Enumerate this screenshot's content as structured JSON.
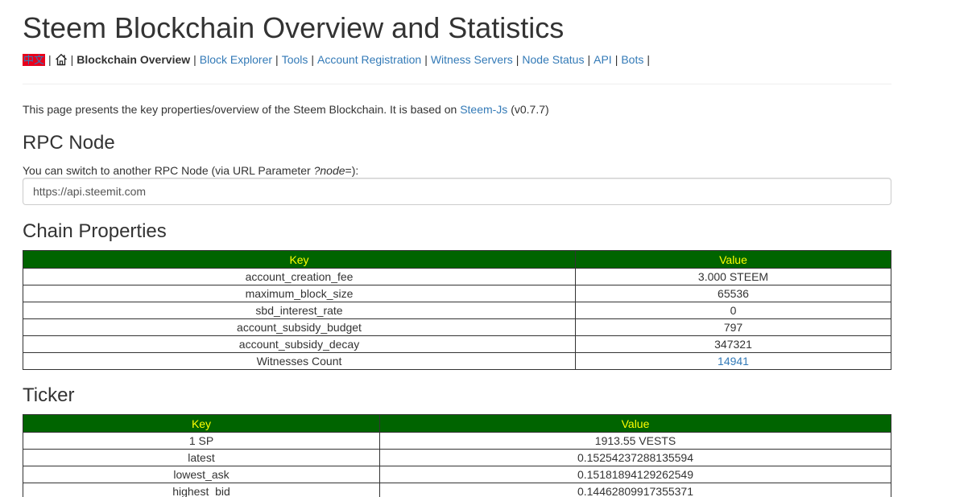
{
  "header": {
    "title": "Steem Blockchain Overview and Statistics"
  },
  "nav": {
    "lang_label": "中文",
    "separator": "|",
    "active_label": "Blockchain Overview",
    "links": [
      "Block Explorer",
      "Tools",
      "Account Registration",
      "Witness Servers",
      "Node Status",
      "API",
      "Bots"
    ]
  },
  "intro": {
    "text_before": "This page presents the key properties/overview of the Steem Blockchain. It is based on ",
    "link_text": "Steem-Js",
    "text_after": " (v0.7.7)"
  },
  "rpc": {
    "heading": "RPC Node",
    "label_prefix": "You can switch to another RPC Node (via URL Parameter ",
    "label_param": "?node",
    "label_suffix": "=):",
    "input_value": "https://api.steemit.com"
  },
  "chain": {
    "heading": "Chain Properties",
    "headers": [
      "Key",
      "Value"
    ],
    "rows": [
      [
        "account_creation_fee",
        "3.000 STEEM"
      ],
      [
        "maximum_block_size",
        "65536"
      ],
      [
        "sbd_interest_rate",
        "0"
      ],
      [
        "account_subsidy_budget",
        "797"
      ],
      [
        "account_subsidy_decay",
        "347321"
      ]
    ],
    "witness_key": "Witnesses Count",
    "witness_value": "14941"
  },
  "ticker": {
    "heading": "Ticker",
    "headers": [
      "Key",
      "Value"
    ],
    "rows": [
      [
        "1 SP",
        "1913.55 VESTS"
      ],
      [
        "latest",
        "0.15254237288135594"
      ],
      [
        "lowest_ask",
        "0.15181894129262549"
      ],
      [
        "highest_bid",
        "0.14462809917355371"
      ]
    ]
  },
  "colors": {
    "table_header_bg": "#006400",
    "table_header_text": "#ffff00",
    "link": "#337ab7",
    "lang_badge": "#e8001c"
  },
  "icons": {
    "home": "home-icon"
  }
}
